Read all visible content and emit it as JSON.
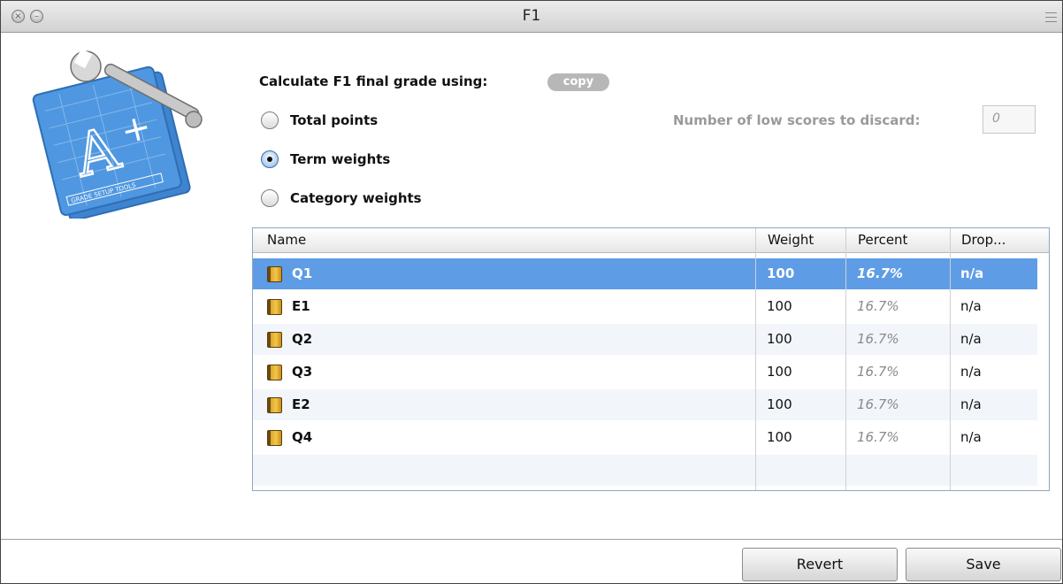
{
  "window": {
    "title": "F1"
  },
  "grade": {
    "label": "Calculate F1 final grade using:",
    "copy_badge": "copy"
  },
  "options": [
    {
      "label": "Total points",
      "selected": false
    },
    {
      "label": "Term weights",
      "selected": true
    },
    {
      "label": "Category weights",
      "selected": false
    }
  ],
  "discard": {
    "label": "Number of low scores to discard:",
    "value": "0"
  },
  "table": {
    "columns": [
      "Name",
      "Weight",
      "Percent",
      "Drop..."
    ],
    "rows": [
      {
        "name": "Q1",
        "weight": "100",
        "percent": "16.7%",
        "drop": "n/a",
        "selected": true
      },
      {
        "name": "E1",
        "weight": "100",
        "percent": "16.7%",
        "drop": "n/a"
      },
      {
        "name": "Q2",
        "weight": "100",
        "percent": "16.7%",
        "drop": "n/a"
      },
      {
        "name": "Q3",
        "weight": "100",
        "percent": "16.7%",
        "drop": "n/a"
      },
      {
        "name": "E2",
        "weight": "100",
        "percent": "16.7%",
        "drop": "n/a"
      },
      {
        "name": "Q4",
        "weight": "100",
        "percent": "16.7%",
        "drop": "n/a"
      }
    ]
  },
  "buttons": {
    "revert": "Revert",
    "save": "Save"
  },
  "icons": {
    "close": "close-icon",
    "minimize": "minimize-icon",
    "menu": "menu-icon",
    "app": "grade-setup-tools-icon",
    "book": "book-icon"
  },
  "colors": {
    "selection": "#5f9ce6",
    "icon_blue": "#4f97e0",
    "book_gold": "#e7b43a"
  },
  "logo_text": "GRADE SETUP TOOLS"
}
